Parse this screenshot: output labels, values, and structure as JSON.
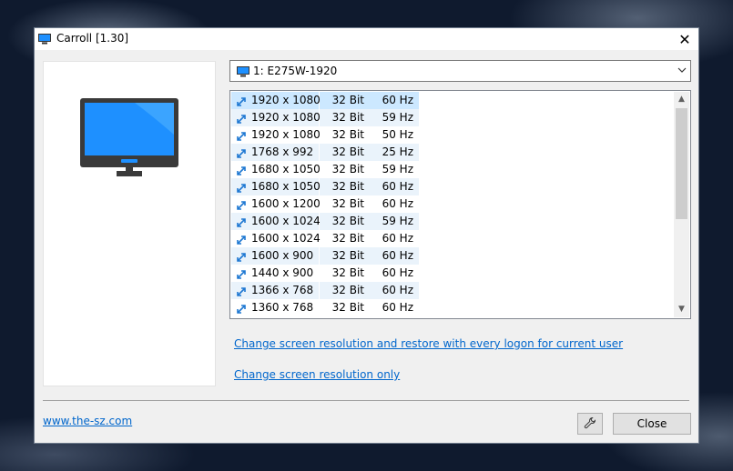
{
  "window": {
    "title": "Carroll [1.30]"
  },
  "monitor_select": {
    "selected": "1: E275W-1920"
  },
  "resolutions": [
    {
      "res": "1920 x 1080",
      "bits": "32 Bit",
      "hz": "60 Hz"
    },
    {
      "res": "1920 x 1080",
      "bits": "32 Bit",
      "hz": "59 Hz"
    },
    {
      "res": "1920 x 1080",
      "bits": "32 Bit",
      "hz": "50 Hz"
    },
    {
      "res": "1768 x 992",
      "bits": "32 Bit",
      "hz": "25 Hz"
    },
    {
      "res": "1680 x 1050",
      "bits": "32 Bit",
      "hz": "59 Hz"
    },
    {
      "res": "1680 x 1050",
      "bits": "32 Bit",
      "hz": "60 Hz"
    },
    {
      "res": "1600 x 1200",
      "bits": "32 Bit",
      "hz": "60 Hz"
    },
    {
      "res": "1600 x 1024",
      "bits": "32 Bit",
      "hz": "59 Hz"
    },
    {
      "res": "1600 x 1024",
      "bits": "32 Bit",
      "hz": "60 Hz"
    },
    {
      "res": "1600 x 900",
      "bits": "32 Bit",
      "hz": "60 Hz"
    },
    {
      "res": "1440 x 900",
      "bits": "32 Bit",
      "hz": "60 Hz"
    },
    {
      "res": "1366 x 768",
      "bits": "32 Bit",
      "hz": "60 Hz"
    },
    {
      "res": "1360 x 768",
      "bits": "32 Bit",
      "hz": "60 Hz"
    }
  ],
  "links": {
    "restore_logon": "Change screen resolution and restore with every logon for current user",
    "change_only": "Change screen resolution only",
    "website": "www.the-sz.com"
  },
  "buttons": {
    "close": "Close"
  },
  "icons": {
    "title": "monitor-icon",
    "preview": "monitor-icon",
    "row": "resize-arrow-icon",
    "tools": "wrench-icon"
  },
  "colors": {
    "accent": "#1e90ff",
    "link": "#0066cc",
    "selected_row": "#cce8ff"
  }
}
